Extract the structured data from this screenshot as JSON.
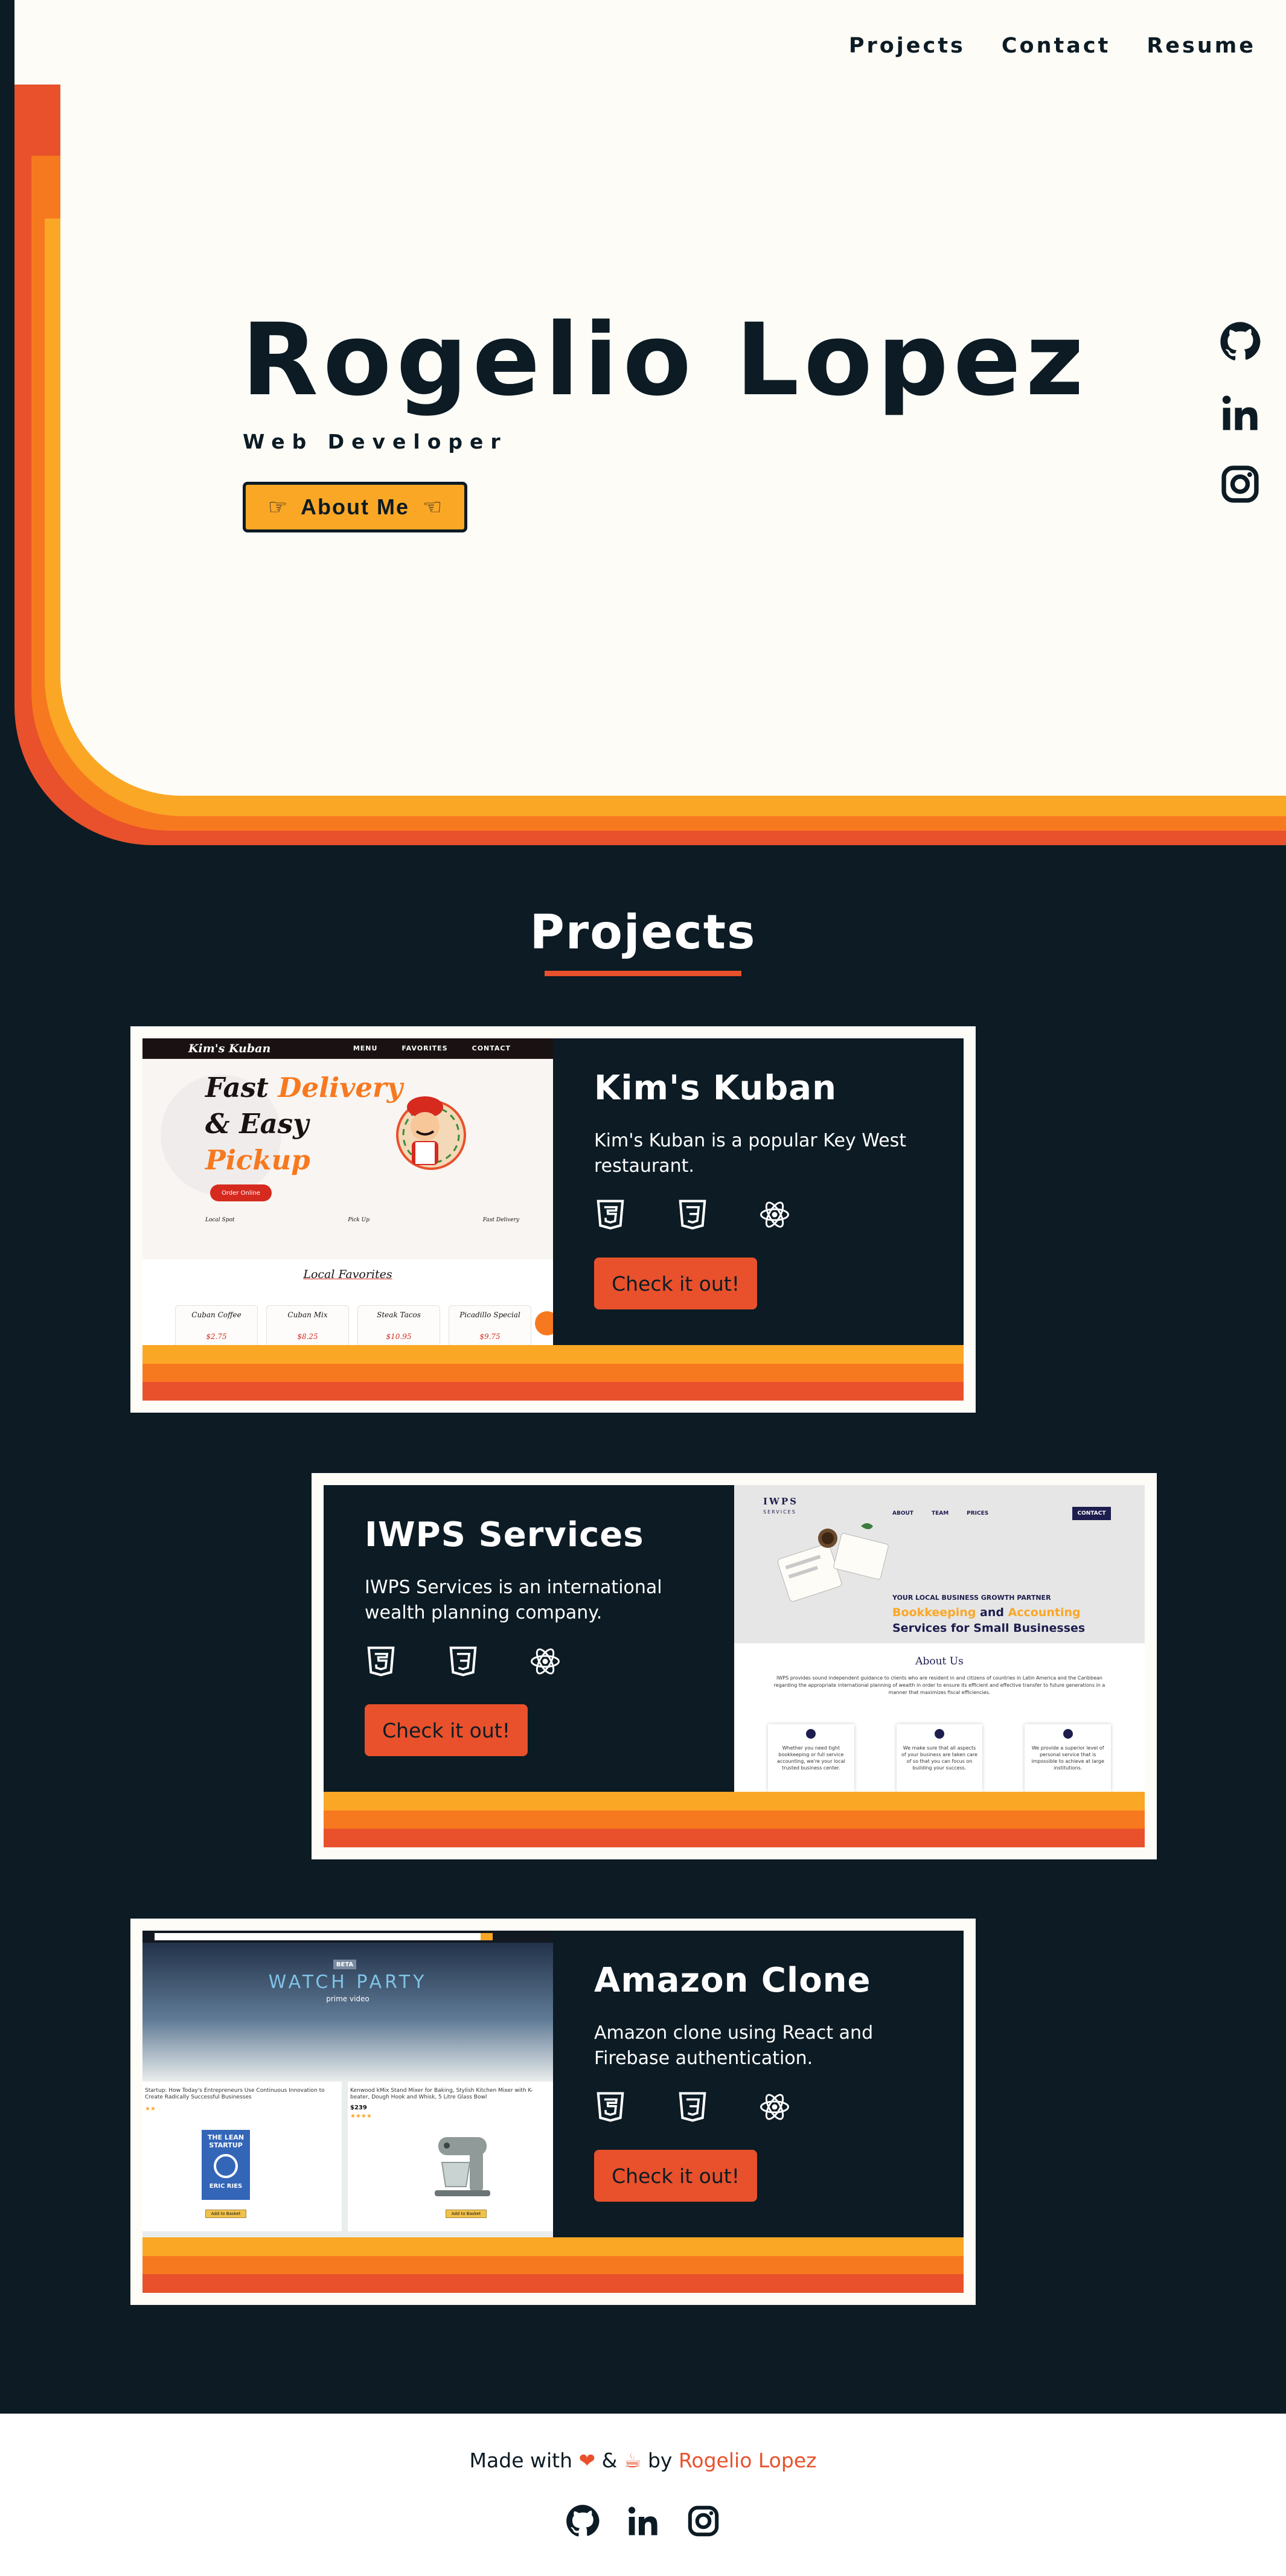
{
  "nav": {
    "items": [
      "Projects",
      "Contact",
      "Resume"
    ]
  },
  "hero": {
    "name": "Rogelio Lopez",
    "role": "Web Developer",
    "about_button": "About Me",
    "social_icons": [
      "github-icon",
      "linkedin-icon",
      "instagram-icon"
    ]
  },
  "projects": {
    "title": "Projects",
    "items": [
      {
        "title": "Kim's Kuban",
        "description": "Kim's Kuban is a popular Key West restaurant.",
        "tech_icons": [
          "html5-icon",
          "css3-icon",
          "react-icon"
        ],
        "button": "Check it out!",
        "preview": {
          "brand": "Kim's Kuban",
          "links": [
            "MENU",
            "FAVORITES",
            "CONTACT"
          ],
          "headline_1": "Fast",
          "headline_2": "Delivery",
          "headline_3": "& Easy",
          "headline_4": "Pickup",
          "order_button": "Order Online",
          "features": [
            "Local Spot",
            "Pick Up",
            "Fast Delivery"
          ],
          "section_title": "Local Favorites",
          "dishes": [
            {
              "name": "Cuban Coffee",
              "price": "$2.75"
            },
            {
              "name": "Cuban Mix",
              "price": "$8.25"
            },
            {
              "name": "Steak Tacos",
              "price": "$10.95"
            },
            {
              "name": "Picadillo Special",
              "price": "$9.75"
            }
          ]
        }
      },
      {
        "title": "IWPS Services",
        "description": "IWPS Services is an international wealth planning company.",
        "tech_icons": [
          "html5-icon",
          "css3-icon",
          "react-icon"
        ],
        "button": "Check it out!",
        "preview": {
          "brand": "IWPS",
          "brand_sub": "SERVICES",
          "links": [
            "ABOUT",
            "TEAM",
            "PRICES"
          ],
          "contact": "CONTACT",
          "kicker": "YOUR LOCAL BUSINESS GROWTH PARTNER",
          "headline_1": "Bookkeeping",
          "headline_and": "and",
          "headline_2": "Accounting",
          "headline_3": "Services for Small Businesses",
          "section_title": "About Us",
          "about_text": "IWPS provides sound independent guidance to clients who are resident in and citizens of countries in Latin America and the Caribbean regarding the appropriate international planning of wealth in order to ensure its efficient and effective transfer to future generations in a manner that maximizes fiscal efficiencies.",
          "features": [
            "Whether you need tight bookkeeping or full service accounting, we're your local trusted business center.",
            "We make sure that all aspects of your business are taken care of so that you can focus on building your success.",
            "We provide a superior level of personal service that is impossible to achieve at large institutions."
          ]
        }
      },
      {
        "title": "Amazon Clone",
        "description": "Amazon clone using React and Firebase authentication.",
        "tech_icons": [
          "html5-icon",
          "css3-icon",
          "react-icon"
        ],
        "button": "Check it out!",
        "preview": {
          "badge": "BETA",
          "banner_title": "WATCH PARTY",
          "banner_sub": "prime video",
          "product_1": "Startup: How Today's Entrepreneurs Use Continuous Innovation to Create Radically Successful Businesses",
          "product_2": "Kenwood kMix Stand Mixer for Baking, Stylish Kitchen Mixer with K-beater, Dough Hook and Whisk, 5 Litre Glass Bowl",
          "product_2_price": "$239",
          "book_title": "THE LEAN STARTUP",
          "book_author": "ERIC RIES",
          "add_button": "Add to Basket"
        }
      }
    ]
  },
  "footer": {
    "made_with": "Made with",
    "and": "&",
    "by": "by",
    "name": "Rogelio Lopez",
    "social_icons": [
      "github-icon",
      "linkedin-icon",
      "instagram-icon"
    ]
  },
  "colors": {
    "navy": "#0c1b24",
    "cream": "#fdfcf7",
    "red": "#e8512c",
    "orange": "#f7791f",
    "yellow": "#fba726"
  }
}
